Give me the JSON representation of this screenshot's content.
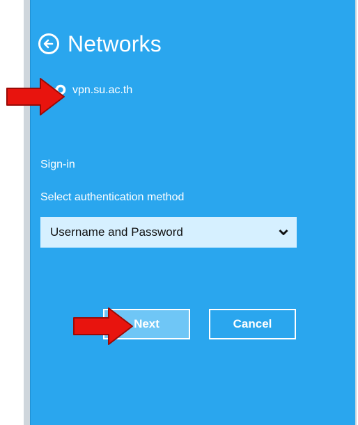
{
  "header": {
    "title": "Networks",
    "back_icon": "arrow-left-circle-icon"
  },
  "network": {
    "icon": "vpn-link-icon",
    "name": "vpn.su.ac.th"
  },
  "signin": {
    "section_label": "Sign-in",
    "method_label": "Select authentication method",
    "method_value": "Username and Password"
  },
  "buttons": {
    "next_label": "Next",
    "cancel_label": "Cancel"
  },
  "annotations": {
    "arrow_color": "#e8140e",
    "arrow_icon": "red-pointer-arrow-icon"
  },
  "colors": {
    "panel_bg": "#2aa6ee",
    "select_bg": "#d6f0ff",
    "next_bg": "#6fc6f6"
  }
}
